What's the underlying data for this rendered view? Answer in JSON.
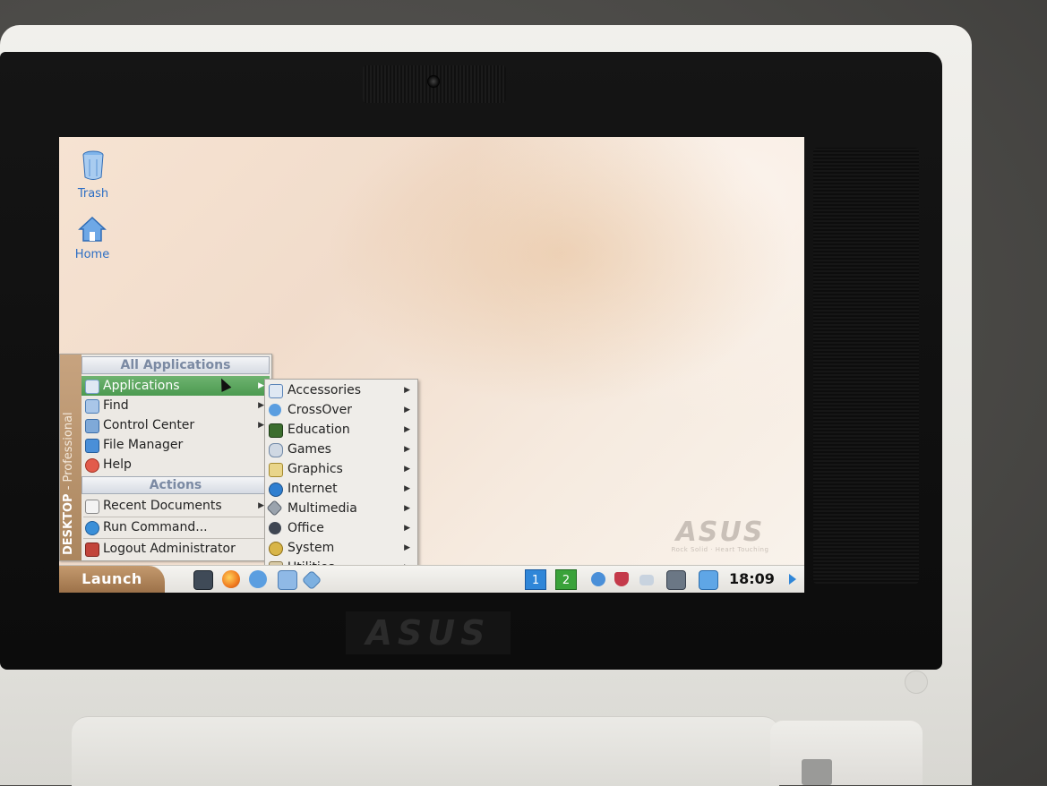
{
  "desktop": {
    "icons": [
      {
        "label": "Trash",
        "icon": "trash-icon"
      },
      {
        "label": "Home",
        "icon": "home-icon"
      }
    ],
    "watermark": {
      "logo": "ASUS",
      "tagline": "Rock Solid · Heart Touching"
    }
  },
  "start_menu": {
    "side_label_bold": "DESKTOP",
    "side_label_thin": " - Professional",
    "section_all": "All Applications",
    "items": [
      {
        "label": "Applications",
        "icon": "applications-icon",
        "has_submenu": true,
        "selected": true
      },
      {
        "label": "Find",
        "icon": "find-icon",
        "has_submenu": true
      },
      {
        "label": "Control Center",
        "icon": "control-center-icon",
        "has_submenu": true
      },
      {
        "label": "File Manager",
        "icon": "file-manager-icon",
        "has_submenu": false
      },
      {
        "label": "Help",
        "icon": "help-icon",
        "has_submenu": false
      }
    ],
    "section_actions": "Actions",
    "actions": [
      {
        "label": "Recent Documents",
        "icon": "recent-documents-icon",
        "has_submenu": true
      },
      {
        "label": "Run Command...",
        "icon": "run-command-icon",
        "has_submenu": false
      },
      {
        "label": "Logout Administrator",
        "icon": "logout-icon",
        "has_submenu": false
      }
    ]
  },
  "applications_submenu": {
    "items": [
      {
        "label": "Accessories",
        "icon": "accessories-icon"
      },
      {
        "label": "CrossOver",
        "icon": "crossover-icon"
      },
      {
        "label": "Education",
        "icon": "education-icon"
      },
      {
        "label": "Games",
        "icon": "games-icon"
      },
      {
        "label": "Graphics",
        "icon": "graphics-icon"
      },
      {
        "label": "Internet",
        "icon": "internet-icon"
      },
      {
        "label": "Multimedia",
        "icon": "multimedia-icon"
      },
      {
        "label": "Office",
        "icon": "office-icon"
      },
      {
        "label": "System",
        "icon": "system-icon"
      },
      {
        "label": "Utilities",
        "icon": "utilities-icon"
      }
    ]
  },
  "taskbar": {
    "launch_label": "Launch",
    "workspaces": [
      "1",
      "2"
    ],
    "clock": "18:09",
    "colors": {
      "workspace_1": "#2f86d8",
      "workspace_2": "#3aa23a",
      "selection": "#4c9a50"
    }
  },
  "hardware": {
    "bezel_logo": "ASUS"
  }
}
